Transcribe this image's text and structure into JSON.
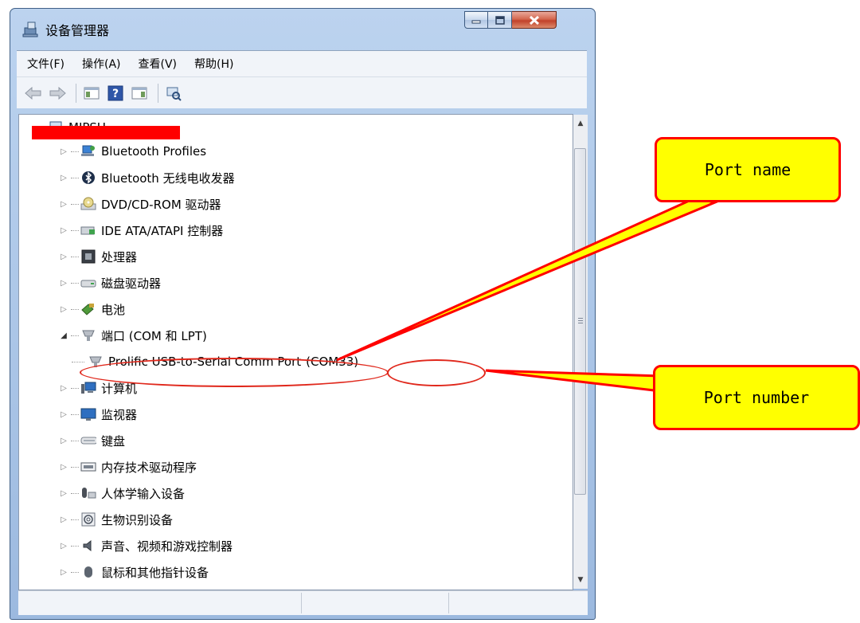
{
  "window": {
    "title": "设备管理器"
  },
  "menu": [
    "文件(F)",
    "操作(A)",
    "查看(V)",
    "帮助(H)"
  ],
  "toolbar": {
    "buttons": [
      "back-arrow-icon",
      "forward-arrow-icon",
      "show-hide-console-tree-icon",
      "help-icon",
      "action-pane-icon",
      "scan-hardware-icon"
    ]
  },
  "tree": {
    "root_label": "MIPSU",
    "categories": [
      {
        "label": "Bluetooth Profiles",
        "icon": "bluetooth-profiles-icon",
        "expanded": false
      },
      {
        "label": "Bluetooth 无线电收发器",
        "icon": "bluetooth-icon",
        "expanded": false
      },
      {
        "label": "DVD/CD-ROM 驱动器",
        "icon": "dvd-drive-icon",
        "expanded": false
      },
      {
        "label": "IDE ATA/ATAPI 控制器",
        "icon": "ide-controller-icon",
        "expanded": false
      },
      {
        "label": "处理器",
        "icon": "processor-icon",
        "expanded": false
      },
      {
        "label": "磁盘驱动器",
        "icon": "disk-drive-icon",
        "expanded": false
      },
      {
        "label": "电池",
        "icon": "battery-icon",
        "expanded": false
      },
      {
        "label": "端口 (COM 和 LPT)",
        "icon": "port-icon",
        "expanded": true
      },
      {
        "label": "计算机",
        "icon": "computer-icon",
        "expanded": false
      },
      {
        "label": "监视器",
        "icon": "monitor-icon",
        "expanded": false
      },
      {
        "label": "键盘",
        "icon": "keyboard-icon",
        "expanded": false
      },
      {
        "label": "内存技术驱动程序",
        "icon": "memory-icon",
        "expanded": false
      },
      {
        "label": "人体学输入设备",
        "icon": "hid-icon",
        "expanded": false
      },
      {
        "label": "生物识别设备",
        "icon": "biometric-icon",
        "expanded": false
      },
      {
        "label": "声音、视频和游戏控制器",
        "icon": "sound-icon",
        "expanded": false
      },
      {
        "label": "鼠标和其他指针设备",
        "icon": "mouse-icon",
        "expanded": false
      }
    ],
    "port_child": {
      "name": "Prolific USB-to-Serial Comm Port",
      "number": "(COM33)"
    }
  },
  "annotations": {
    "port_name": "Port name",
    "port_number": "Port number",
    "colors": {
      "fill": "#ffff00",
      "border": "#ff0000",
      "ellipse": "#e0281c"
    }
  }
}
